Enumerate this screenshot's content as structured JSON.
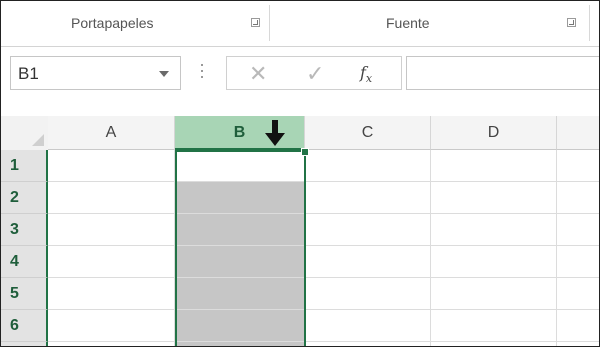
{
  "ribbon": {
    "groups": [
      {
        "label": "Portapapeles"
      },
      {
        "label": "Fuente"
      }
    ]
  },
  "formula_bar": {
    "name_box_value": "B1",
    "cancel_glyph": "✕",
    "enter_glyph": "✓",
    "function_label": "fx",
    "formula_value": ""
  },
  "sheet": {
    "columns": [
      "A",
      "B",
      "C",
      "D"
    ],
    "rows": [
      "1",
      "2",
      "3",
      "4",
      "5",
      "6"
    ],
    "selected_column": "B",
    "active_cell": "B1",
    "selection_range": "B1:B6"
  },
  "colors": {
    "accent": "#217346",
    "selected_header": "#a8d5b5",
    "selection_fill": "#c6c6c6"
  },
  "icons": {
    "dialog_launcher": "dialog-launcher-icon",
    "dropdown": "chevron-down-icon",
    "cancel": "cancel-icon",
    "enter": "check-icon",
    "insert_function": "fx-icon",
    "select_column_cursor": "down-arrow-icon"
  }
}
